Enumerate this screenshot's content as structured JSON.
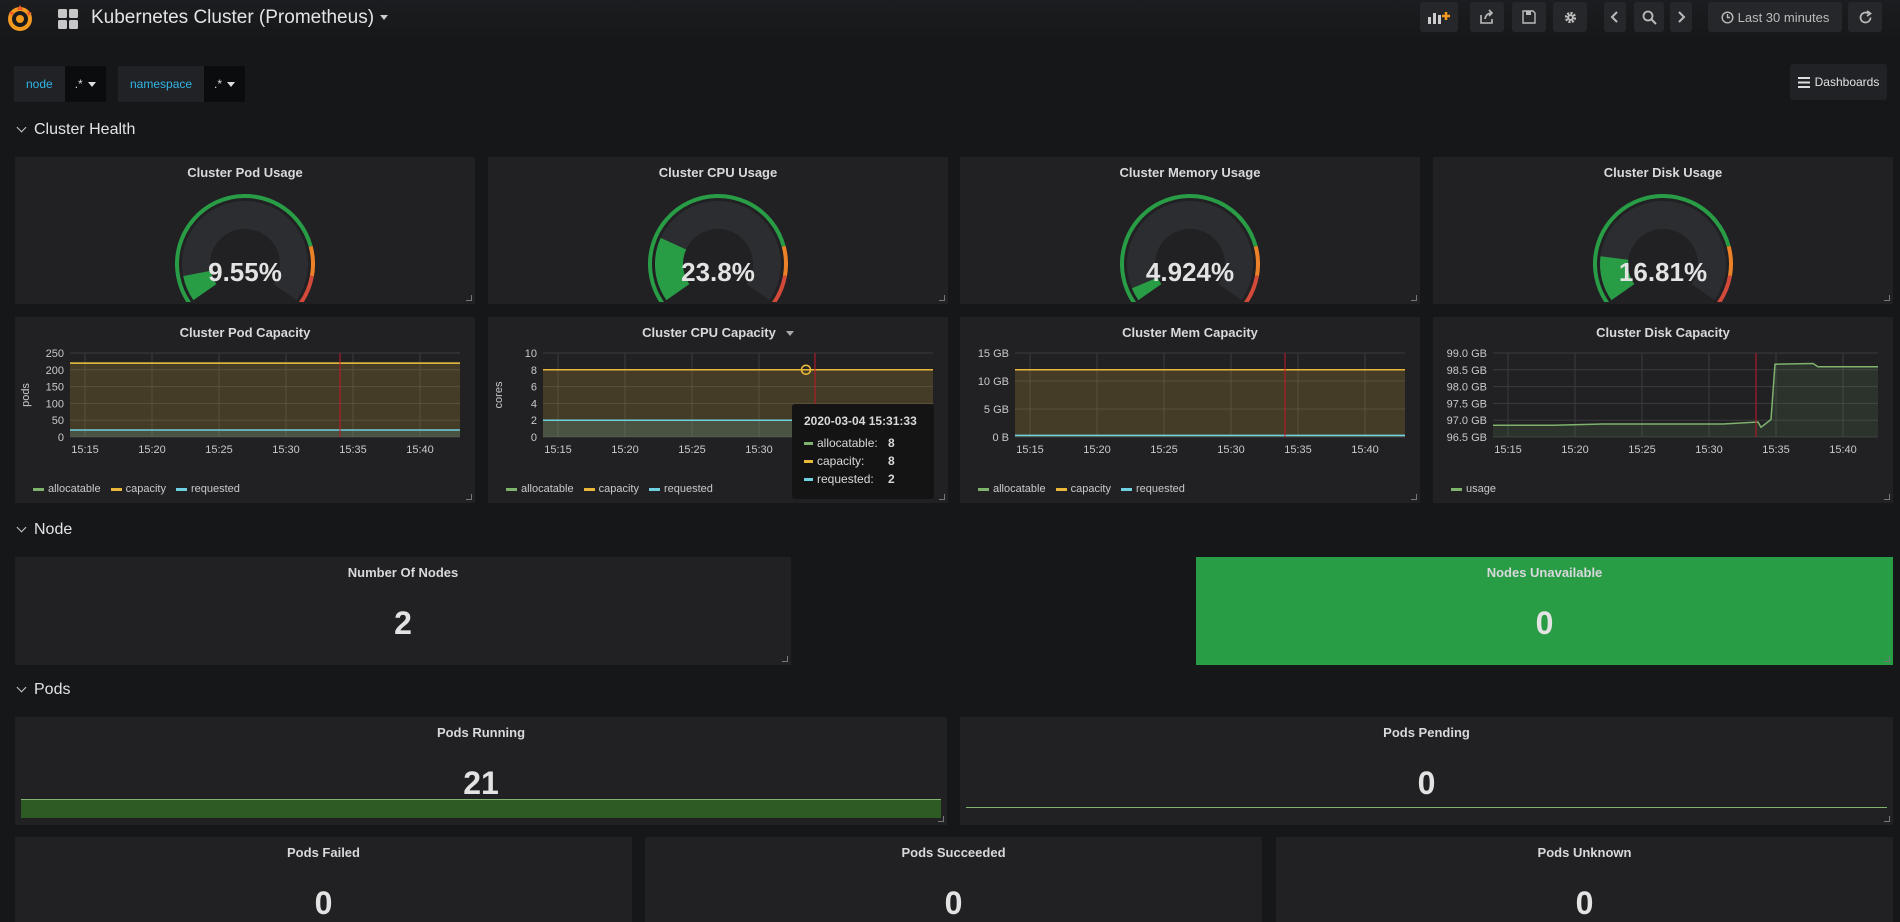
{
  "header": {
    "title": "Kubernetes Cluster (Prometheus)",
    "time_range": "Last 30 minutes"
  },
  "variables": [
    {
      "label": "node",
      "value": ".*"
    },
    {
      "label": "namespace",
      "value": ".*"
    }
  ],
  "dashboards_label": "Dashboards",
  "rows": {
    "cluster_health": "Cluster Health",
    "node": "Node",
    "pods": "Pods"
  },
  "gauges": [
    {
      "title": "Cluster Pod Usage",
      "value": "9.55%",
      "percent": 9.55
    },
    {
      "title": "Cluster CPU Usage",
      "value": "23.8%",
      "percent": 23.8
    },
    {
      "title": "Cluster Memory Usage",
      "value": "4.924%",
      "percent": 4.924
    },
    {
      "title": "Cluster Disk Usage",
      "value": "16.81%",
      "percent": 16.81
    }
  ],
  "colors": {
    "green": "#299c46",
    "orange": "#ed8128",
    "red": "#d44a3a",
    "allocatable": "#7eb26d",
    "capacity": "#eab839",
    "requested": "#6ed0e0",
    "usage": "#7eb26d"
  },
  "chart_data": [
    {
      "type": "line",
      "title": "Cluster Pod Capacity",
      "ylabel": "pods",
      "y_ticks": [
        "250",
        "200",
        "150",
        "100",
        "50",
        "0"
      ],
      "x_ticks": [
        "15:15",
        "15:20",
        "15:25",
        "15:30",
        "15:35",
        "15:40"
      ],
      "ylim": [
        0,
        250
      ],
      "series": [
        {
          "name": "allocatable",
          "value": 220
        },
        {
          "name": "capacity",
          "value": 220
        },
        {
          "name": "requested",
          "value": 21
        }
      ]
    },
    {
      "type": "line",
      "title": "Cluster CPU Capacity",
      "ylabel": "cores",
      "y_ticks": [
        "10",
        "8",
        "6",
        "4",
        "2",
        "0"
      ],
      "x_ticks": [
        "15:15",
        "15:20",
        "15:25",
        "15:30"
      ],
      "ylim": [
        0,
        10
      ],
      "series": [
        {
          "name": "allocatable",
          "value": 8
        },
        {
          "name": "capacity",
          "value": 8
        },
        {
          "name": "requested",
          "value": 2
        }
      ],
      "tooltip": {
        "time": "2020-03-04 15:31:33",
        "rows": [
          {
            "name": "allocatable:",
            "value": "8"
          },
          {
            "name": "capacity:",
            "value": "8"
          },
          {
            "name": "requested:",
            "value": "2"
          }
        ]
      }
    },
    {
      "type": "line",
      "title": "Cluster Mem Capacity",
      "y_ticks": [
        "15 GB",
        "10 GB",
        "5 GB",
        "0 B"
      ],
      "x_ticks": [
        "15:15",
        "15:20",
        "15:25",
        "15:30",
        "15:35",
        "15:40"
      ],
      "ylim": [
        0,
        15
      ],
      "series": [
        {
          "name": "allocatable",
          "value": 12
        },
        {
          "name": "capacity",
          "value": 12
        },
        {
          "name": "requested",
          "value": 0.3
        }
      ]
    },
    {
      "type": "line",
      "title": "Cluster Disk Capacity",
      "y_ticks": [
        "99.0 GB",
        "98.5 GB",
        "98.0 GB",
        "97.5 GB",
        "97.0 GB",
        "96.5 GB"
      ],
      "x_ticks": [
        "15:15",
        "15:20",
        "15:25",
        "15:30",
        "15:35",
        "15:40"
      ],
      "ylim": [
        96.5,
        99.0
      ],
      "series": [
        {
          "name": "usage"
        }
      ]
    }
  ],
  "stats": {
    "number_of_nodes": {
      "title": "Number Of Nodes",
      "value": "2"
    },
    "nodes_unavailable": {
      "title": "Nodes Unavailable",
      "value": "0"
    },
    "pods_running": {
      "title": "Pods Running",
      "value": "21"
    },
    "pods_pending": {
      "title": "Pods Pending",
      "value": "0"
    },
    "pods_failed": {
      "title": "Pods Failed",
      "value": "0"
    },
    "pods_succeeded": {
      "title": "Pods Succeeded",
      "value": "0"
    },
    "pods_unknown": {
      "title": "Pods Unknown",
      "value": "0"
    }
  }
}
